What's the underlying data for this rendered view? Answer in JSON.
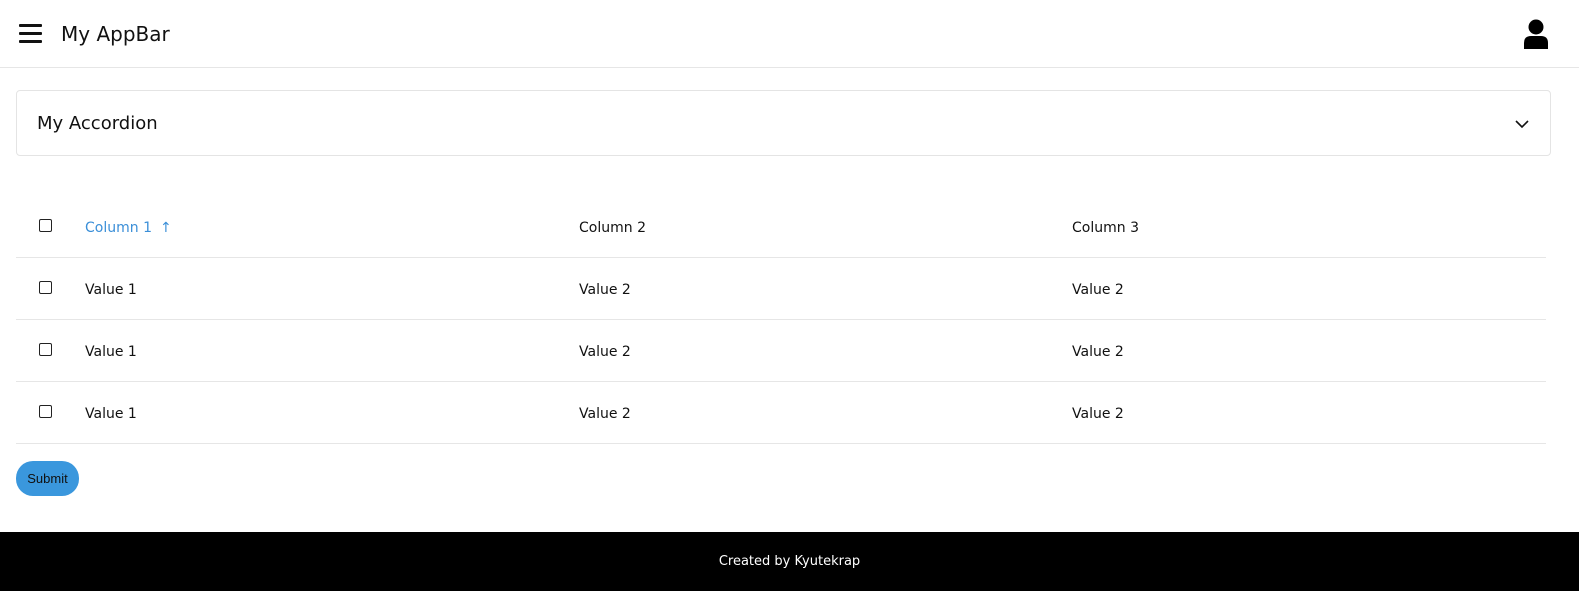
{
  "appbar": {
    "title": "My AppBar",
    "menu_icon": "menu-icon",
    "account_icon": "account-icon"
  },
  "accordion": {
    "title": "My Accordion",
    "expand_icon": "chevron-down-icon"
  },
  "table": {
    "columns": [
      "Column 1",
      "Column 2",
      "Column 3"
    ],
    "sort": {
      "column": "Column 1",
      "direction": "ascending",
      "icon": "arrow-up-icon",
      "color": "#3b8fd8"
    },
    "rows": [
      [
        "Value 1",
        "Value 2",
        "Value 2"
      ],
      [
        "Value 1",
        "Value 2",
        "Value 2"
      ],
      [
        "Value 1",
        "Value 2",
        "Value 2"
      ]
    ]
  },
  "submit": {
    "label": "Submit",
    "color": "#3a97dd"
  },
  "footer": {
    "text": "Created by Kyutekrap",
    "background": "#000000"
  }
}
